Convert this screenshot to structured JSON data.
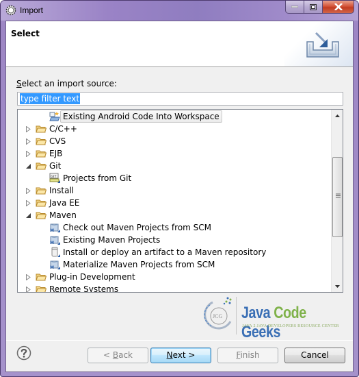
{
  "window": {
    "title": "Import",
    "controls": [
      "minimize",
      "maximize",
      "close"
    ]
  },
  "header": {
    "title": "Select",
    "graphic": "import-wizard-banner-icon"
  },
  "source": {
    "label_prefix": "S",
    "label_rest": "elect an import source:",
    "filter_value": "type filter text"
  },
  "tree": {
    "items": [
      {
        "label": "Existing Android Code Into Workspace",
        "level": 1,
        "icon": "android-project-icon",
        "selected": true
      },
      {
        "label": "C/C++",
        "level": 0,
        "icon": "folder-icon",
        "expandable": true,
        "expanded": false
      },
      {
        "label": "CVS",
        "level": 0,
        "icon": "folder-icon",
        "expandable": true,
        "expanded": false
      },
      {
        "label": "EJB",
        "level": 0,
        "icon": "folder-icon",
        "expandable": true,
        "expanded": false
      },
      {
        "label": "Git",
        "level": 0,
        "icon": "folder-icon",
        "expandable": true,
        "expanded": true
      },
      {
        "label": "Projects from Git",
        "level": 1,
        "icon": "git-repo-icon"
      },
      {
        "label": "Install",
        "level": 0,
        "icon": "folder-icon",
        "expandable": true,
        "expanded": false
      },
      {
        "label": "Java EE",
        "level": 0,
        "icon": "folder-icon",
        "expandable": true,
        "expanded": false
      },
      {
        "label": "Maven",
        "level": 0,
        "icon": "folder-icon",
        "expandable": true,
        "expanded": true
      },
      {
        "label": "Check out Maven Projects from SCM",
        "level": 1,
        "icon": "maven-project-icon"
      },
      {
        "label": "Existing Maven Projects",
        "level": 1,
        "icon": "maven-project-icon"
      },
      {
        "label": "Install or deploy an artifact to a Maven repository",
        "level": 1,
        "icon": "jar-icon"
      },
      {
        "label": "Materialize Maven Projects from SCM",
        "level": 1,
        "icon": "maven-project-icon"
      },
      {
        "label": "Plug-in Development",
        "level": 0,
        "icon": "folder-icon",
        "expandable": true,
        "expanded": false
      },
      {
        "label": "Remote Systems",
        "level": 0,
        "icon": "folder-icon",
        "expandable": true,
        "expanded": false
      }
    ]
  },
  "logo": {
    "java": "Java",
    "code": "Code",
    "geeks": "Geeks",
    "monogram": "JCG",
    "tagline": "JAVA 2 JAVA DEVELOPERS RESOURCE CENTER"
  },
  "buttons": {
    "back": {
      "prefix": "< ",
      "mnemonic": "B",
      "rest": "ack",
      "enabled": false
    },
    "next": {
      "mnemonic": "N",
      "rest": "ext >",
      "enabled": true
    },
    "finish": {
      "mnemonic": "F",
      "rest": "inish",
      "enabled": false
    },
    "cancel": {
      "label": "Cancel",
      "enabled": true
    }
  }
}
